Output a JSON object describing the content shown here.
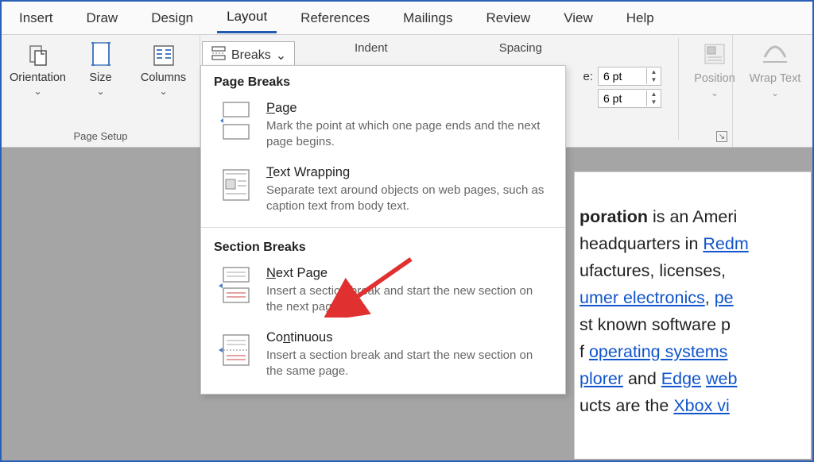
{
  "tabs": {
    "insert": "Insert",
    "draw": "Draw",
    "design": "Design",
    "layout": "Layout",
    "references": "References",
    "mailings": "Mailings",
    "review": "Review",
    "view": "View",
    "help": "Help"
  },
  "page_setup": {
    "orientation": "Orientation",
    "size": "Size",
    "columns": "Columns",
    "group_label": "Page Setup",
    "breaks_label": "Breaks"
  },
  "para": {
    "indent_label": "Indent",
    "spacing_label": "Spacing",
    "before_prefix": "e:",
    "before_value": "6 pt",
    "after_value": "6 pt"
  },
  "arrange": {
    "position": "Position",
    "wrap": "Wrap Text"
  },
  "breaks_menu": {
    "page_breaks_header": "Page Breaks",
    "section_breaks_header": "Section Breaks",
    "items": [
      {
        "title_pre": "P",
        "title_rest": "age",
        "desc": "Mark the point at which one page ends and the next page begins."
      },
      {
        "title_pre": "T",
        "title_rest": "ext Wrapping",
        "desc": "Separate text around objects on web pages, such as caption text from body text."
      },
      {
        "title_pre": "N",
        "title_rest": "ext Page",
        "desc": "Insert a section break and start the new section on the next page."
      },
      {
        "title_pre": "Co",
        "title_underline": "n",
        "title_post": "tinuous",
        "desc": "Insert a section break and start the new section on the same page."
      }
    ]
  },
  "doc": {
    "l1a": "poration",
    "l1b": " is an Ameri",
    "l2a": "headquarters in ",
    "l2link": "Redm",
    "l3a": "ufactures, licenses, ",
    "l4link": "umer electronics",
    "l4b": ", ",
    "l4link2": "pe",
    "l5a": "st known software p",
    "l6a": "f ",
    "l6link": "operating systems",
    "l7link1": "plorer",
    "l7a": " and ",
    "l7link2": "Edge",
    "l7b": " ",
    "l7link3": "web",
    "l8a": "ucts are the ",
    "l8link": "Xbox vi"
  }
}
